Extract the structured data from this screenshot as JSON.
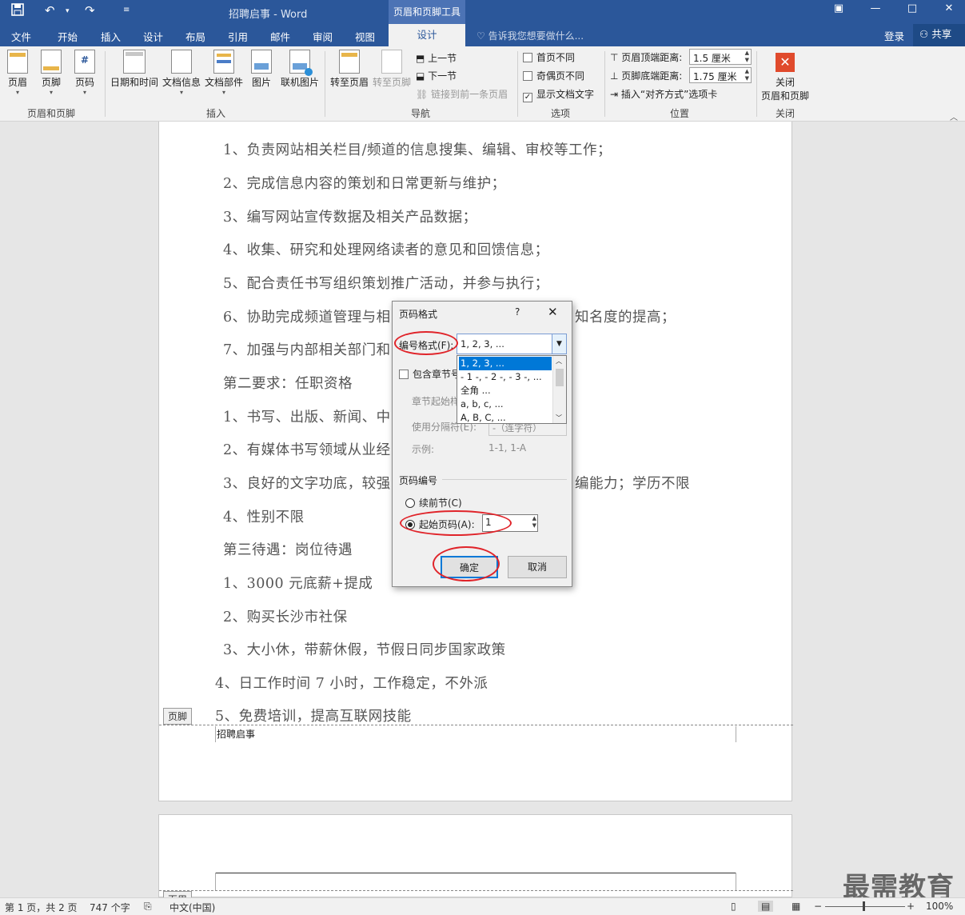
{
  "titlebar": {
    "doc_title": "招聘启事 - Word",
    "context_tab": "页眉和页脚工具",
    "quick_access": [
      "save-icon",
      "undo-icon",
      "redo-icon",
      "customize-icon"
    ],
    "window_buttons": [
      "ribbon-options-icon",
      "minimize-icon",
      "maximize-icon",
      "close-icon"
    ]
  },
  "tabs": {
    "items": [
      "文件",
      "开始",
      "插入",
      "设计",
      "布局",
      "引用",
      "邮件",
      "审阅",
      "视图"
    ],
    "active": "设计",
    "tell_me": "告诉我您想要做什么...",
    "login": "登录",
    "share": "共享"
  },
  "ribbon": {
    "group1": {
      "label": "页眉和页脚",
      "buttons": [
        "页眉",
        "页脚",
        "页码"
      ]
    },
    "group2": {
      "label": "插入",
      "buttons": [
        "日期和时间",
        "文档信息",
        "文档部件",
        "图片",
        "联机图片"
      ]
    },
    "group3": {
      "label": "导航",
      "buttons": [
        "转至页眉",
        "转至页脚"
      ],
      "small": [
        "上一节",
        "下一节",
        "链接到前一条页眉"
      ]
    },
    "group4": {
      "label": "选项",
      "checks": [
        "首页不同",
        "奇偶页不同",
        "显示文档文字"
      ],
      "checked": [
        false,
        false,
        true
      ]
    },
    "group5": {
      "label": "位置",
      "header_dist_label": "页眉顶端距离:",
      "header_dist": "1.5 厘米",
      "footer_dist_label": "页脚底端距离:",
      "footer_dist": "1.75 厘米",
      "insert_tab": "插入“对齐方式”选项卡"
    },
    "group6": {
      "label": "关闭",
      "button_line1": "关闭",
      "button_line2": "页眉和页脚"
    }
  },
  "document": {
    "lines": [
      "1、负责网站相关栏目/频道的信息搜集、编辑、审校等工作；",
      "2、完成信息内容的策划和日常更新与维护；",
      "3、编写网站宣传数据及相关产品数据；",
      "4、收集、研究和处理网络读者的意见和回馈信息；",
      "5、配合责任书写组织策划推广活动，并参与执行；",
      "6、协助完成频道管理与相",
      "7、加强与内部相关部门和",
      "第二要求：任职资格",
      "1、书写、出版、新闻、中",
      "2、有媒体书写领域从业经",
      "3、良好的文字功底，较强",
      "4、性别不限",
      "第三待遇：岗位待遇",
      "1、3000 元底薪+提成",
      "2、购买长沙市社保",
      "3、大小休，带薪休假，节假日同步国家政策",
      "4、日工作时间 7 小时，工作稳定，不外派",
      "5、免费培训，提高互联网技能"
    ],
    "line6_tail": "知名度的提高；",
    "line11_tail": "编能力；学历不限",
    "footer_tag": "页脚",
    "footer_text": "招聘启事",
    "header_tag": "页眉"
  },
  "dialog": {
    "title": "页码格式",
    "help": "?",
    "number_format_label": "编号格式(F):",
    "number_format_value": "1, 2, 3, ...",
    "options": [
      "1, 2, 3, ...",
      "- 1 -, - 2 -, - 3 -, ...",
      "全角 ...",
      "a, b, c, ...",
      "A, B, C, ..."
    ],
    "include_chapter": "包含章节号",
    "chapter_start": "章节起始样",
    "separator_label": "使用分隔符(E):",
    "separator_value": "-（连字符）",
    "example_label": "示例:",
    "example_value": "1-1, 1-A",
    "page_numbering": "页码编号",
    "continue_label": "续前节(C)",
    "start_at_label": "起始页码(A):",
    "start_at_value": "1",
    "ok": "确定",
    "cancel": "取消"
  },
  "statusbar": {
    "page": "第 1 页，共 2 页",
    "words": "747 个字",
    "lang": "中文(中国)",
    "zoom": "100%"
  },
  "watermark": "最需教育"
}
